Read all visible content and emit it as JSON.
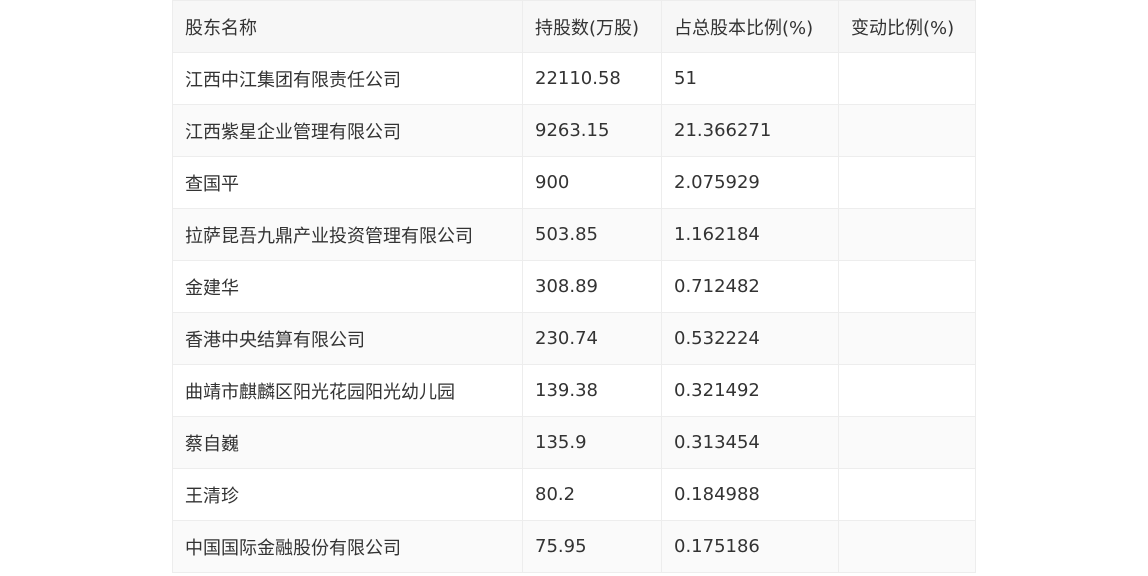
{
  "table": {
    "headers": [
      "股东名称",
      "持股数(万股)",
      "占总股本比例(%)",
      "变动比例(%)"
    ],
    "rows": [
      [
        "江西中江集团有限责任公司",
        "22110.58",
        "51",
        ""
      ],
      [
        "江西紫星企业管理有限公司",
        "9263.15",
        "21.366271",
        ""
      ],
      [
        "查国平",
        "900",
        "2.075929",
        ""
      ],
      [
        "拉萨昆吾九鼎产业投资管理有限公司",
        "503.85",
        "1.162184",
        ""
      ],
      [
        "金建华",
        "308.89",
        "0.712482",
        ""
      ],
      [
        "香港中央结算有限公司",
        "230.74",
        "0.532224",
        ""
      ],
      [
        "曲靖市麒麟区阳光花园阳光幼儿园",
        "139.38",
        "0.321492",
        ""
      ],
      [
        "蔡自巍",
        "135.9",
        "0.313454",
        ""
      ],
      [
        "王清珍",
        "80.2",
        "0.184988",
        ""
      ],
      [
        "中国国际金融股份有限公司",
        "75.95",
        "0.175186",
        ""
      ]
    ]
  }
}
